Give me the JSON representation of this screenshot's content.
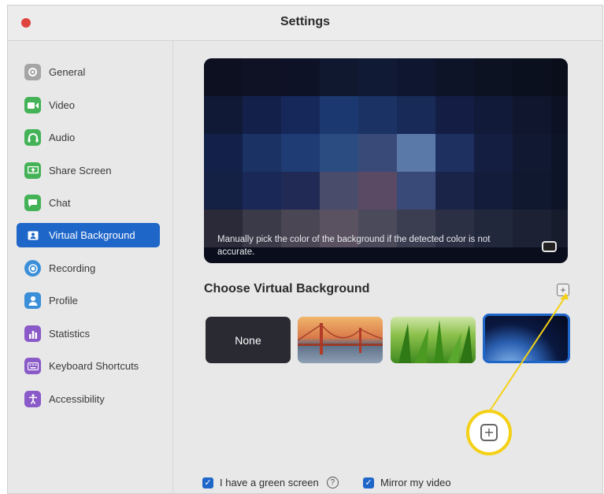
{
  "window": {
    "title": "Settings"
  },
  "sidebar": {
    "items": [
      {
        "label": "General",
        "icon": "gear-icon",
        "color": "#8f8f8f"
      },
      {
        "label": "Video",
        "icon": "video-camera-icon",
        "color": "#3fae52"
      },
      {
        "label": "Audio",
        "icon": "headphones-icon",
        "color": "#3fae52"
      },
      {
        "label": "Share Screen",
        "icon": "share-screen-icon",
        "color": "#3fae52"
      },
      {
        "label": "Chat",
        "icon": "chat-bubble-icon",
        "color": "#3fae52"
      },
      {
        "label": "Virtual Background",
        "icon": "person-card-icon",
        "color": "#ffffff",
        "active": true
      },
      {
        "label": "Recording",
        "icon": "record-icon",
        "color": "#3b8fd9"
      },
      {
        "label": "Profile",
        "icon": "person-icon",
        "color": "#3b8fd9"
      },
      {
        "label": "Statistics",
        "icon": "bar-chart-icon",
        "color": "#8a5ac8"
      },
      {
        "label": "Keyboard Shortcuts",
        "icon": "keyboard-icon",
        "color": "#8a5ac8"
      },
      {
        "label": "Accessibility",
        "icon": "accessibility-icon",
        "color": "#8a5ac8"
      }
    ]
  },
  "preview": {
    "caption": "Manually pick the color of the background if the detected color is not accurate."
  },
  "virtual_background": {
    "section_title": "Choose Virtual Background",
    "add_symbol": "+",
    "thumbnails": [
      {
        "label": "None"
      },
      {
        "label": ""
      },
      {
        "label": ""
      },
      {
        "label": ""
      }
    ]
  },
  "options": {
    "green_screen_label": "I have a green screen",
    "mirror_label": "Mirror my video",
    "help_symbol": "?"
  },
  "callout": {
    "symbol": "+",
    "color": "#f4d116"
  }
}
